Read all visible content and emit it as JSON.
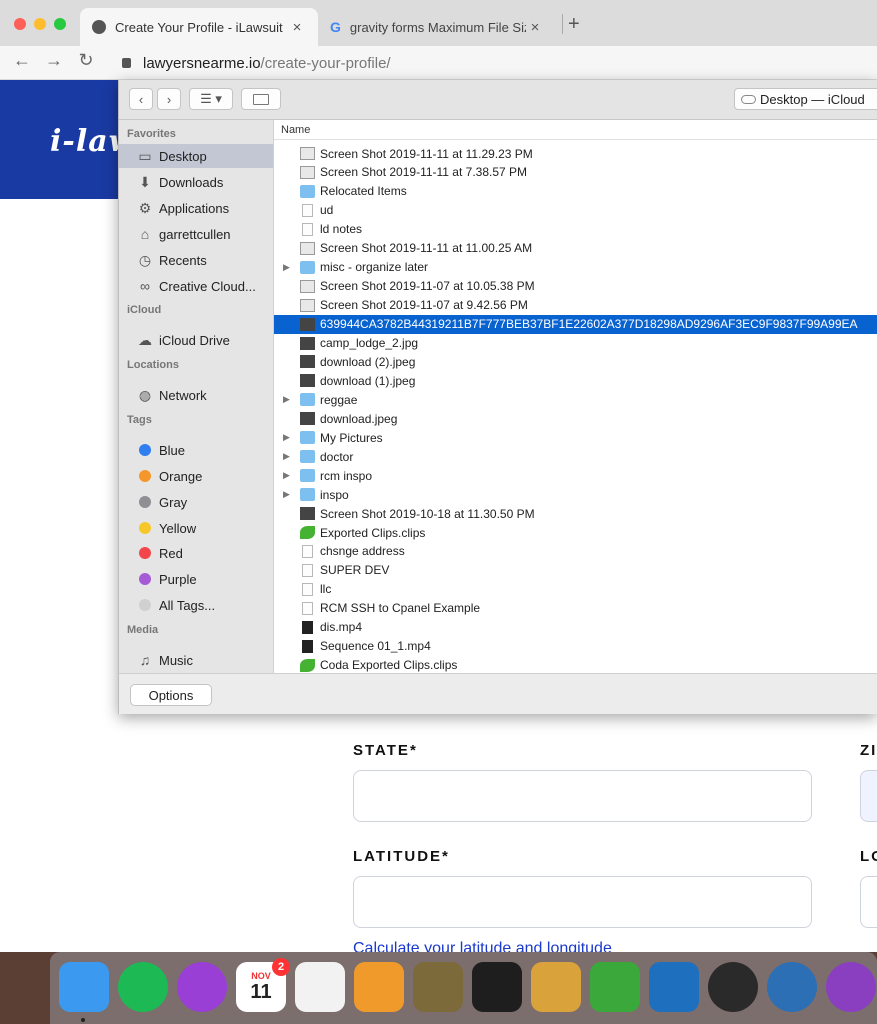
{
  "browser": {
    "tabs": [
      {
        "title": "Create Your Profile - iLawsuit",
        "close": "×"
      },
      {
        "title": "gravity forms Maximum File Size",
        "close": "×"
      }
    ],
    "new_tab": "+",
    "back": "←",
    "forward": "→",
    "reload": "↻",
    "url": {
      "domain": "lawyersnearme.io",
      "path": "/create-your-profile/"
    }
  },
  "page": {
    "logo": "i-law",
    "state_label": "STATE*",
    "zip_label": "ZI",
    "latitude_label": "LATITUDE*",
    "longitude_label": "LO",
    "calc_link": "Calculate your latitude and longitude"
  },
  "dialog": {
    "location": "Desktop — iCloud",
    "column_header": "Name",
    "options_button": "Options",
    "sidebar": [
      {
        "type": "header",
        "label": "Favorites"
      },
      {
        "type": "item",
        "label": "Desktop",
        "icon": "desktop-icon",
        "selected": true
      },
      {
        "type": "item",
        "label": "Downloads",
        "icon": "downloads-icon"
      },
      {
        "type": "item",
        "label": "Applications",
        "icon": "applications-icon"
      },
      {
        "type": "item",
        "label": "garrettcullen",
        "icon": "home-icon"
      },
      {
        "type": "item",
        "label": "Recents",
        "icon": "recents-icon"
      },
      {
        "type": "item",
        "label": "Creative Cloud...",
        "icon": "creative-cloud-icon"
      },
      {
        "type": "header",
        "label": "iCloud"
      },
      {
        "type": "item",
        "label": "iCloud Drive",
        "icon": "icloud-icon"
      },
      {
        "type": "header",
        "label": "Locations"
      },
      {
        "type": "item",
        "label": "Network",
        "icon": "network-icon"
      },
      {
        "type": "header",
        "label": "Tags"
      },
      {
        "type": "tag",
        "label": "Blue",
        "color": "#2f7ff0"
      },
      {
        "type": "tag",
        "label": "Orange",
        "color": "#f5962b"
      },
      {
        "type": "tag",
        "label": "Gray",
        "color": "#8e8e93"
      },
      {
        "type": "tag",
        "label": "Yellow",
        "color": "#f5c72b"
      },
      {
        "type": "tag",
        "label": "Red",
        "color": "#f2464a"
      },
      {
        "type": "tag",
        "label": "Purple",
        "color": "#a65bd6"
      },
      {
        "type": "tag",
        "label": "All Tags...",
        "color": "#d0d0d0"
      },
      {
        "type": "header",
        "label": "Media"
      },
      {
        "type": "item",
        "label": "Music",
        "icon": "music-icon"
      }
    ],
    "files": [
      {
        "name": "Screen Shot 2019-11-11 at 11.29.23 PM",
        "kind": "shot"
      },
      {
        "name": "Screen Shot 2019-11-11 at 7.38.57 PM",
        "kind": "shot"
      },
      {
        "name": "Relocated Items",
        "kind": "folder"
      },
      {
        "name": "ud",
        "kind": "doc"
      },
      {
        "name": "ld notes",
        "kind": "doc"
      },
      {
        "name": "Screen Shot 2019-11-11 at 11.00.25 AM",
        "kind": "shot"
      },
      {
        "name": "misc - organize later",
        "kind": "folder",
        "expandable": true
      },
      {
        "name": "Screen Shot 2019-11-07 at 10.05.38 PM",
        "kind": "shot"
      },
      {
        "name": "Screen Shot 2019-11-07 at 9.42.56 PM",
        "kind": "shot"
      },
      {
        "name": "639944CA3782B44319211B7F777BEB37BF1E22602A377D18298AD9296AF3EC9F9837F99A99EA",
        "kind": "img",
        "selected": true
      },
      {
        "name": "camp_lodge_2.jpg",
        "kind": "img"
      },
      {
        "name": "download (2).jpeg",
        "kind": "img"
      },
      {
        "name": "download (1).jpeg",
        "kind": "img"
      },
      {
        "name": "reggae",
        "kind": "folder",
        "expandable": true
      },
      {
        "name": "download.jpeg",
        "kind": "img"
      },
      {
        "name": "My Pictures",
        "kind": "folder",
        "expandable": true
      },
      {
        "name": "doctor",
        "kind": "folder",
        "expandable": true
      },
      {
        "name": "rcm inspo",
        "kind": "folder",
        "expandable": true
      },
      {
        "name": "inspo",
        "kind": "folder",
        "expandable": true
      },
      {
        "name": "Screen Shot 2019-10-18 at 11.30.50 PM",
        "kind": "img"
      },
      {
        "name": "Exported Clips.clips",
        "kind": "clip"
      },
      {
        "name": "chsnge address",
        "kind": "doc"
      },
      {
        "name": "SUPER DEV",
        "kind": "doc"
      },
      {
        "name": "llc",
        "kind": "doc"
      },
      {
        "name": "RCM SSH to Cpanel Example",
        "kind": "doc"
      },
      {
        "name": "dis.mp4",
        "kind": "vid"
      },
      {
        "name": "Sequence 01_1.mp4",
        "kind": "vid"
      },
      {
        "name": "Coda Exported Clips.clips",
        "kind": "clip"
      }
    ]
  },
  "dock": {
    "calendar_month": "NOV",
    "calendar_day": "11",
    "calendar_badge": "2",
    "apps": [
      {
        "name": "finder-icon",
        "color": "#3b9af0"
      },
      {
        "name": "spotify-icon",
        "color": "#1db954"
      },
      {
        "name": "podcasts-icon",
        "color": "#9a3fd6"
      },
      {
        "name": "calendar-icon",
        "color": "#ffffff"
      },
      {
        "name": "textedit-icon",
        "color": "#f2f2f2"
      },
      {
        "name": "calculator-icon",
        "color": "#f09a2c"
      },
      {
        "name": "gas-mask-icon",
        "color": "#7d6a3b"
      },
      {
        "name": "terminal-icon",
        "color": "#1e1e1e"
      },
      {
        "name": "sequel-pro-icon",
        "color": "#d9a23a"
      },
      {
        "name": "coda-icon",
        "color": "#3aa83a"
      },
      {
        "name": "vscode-icon",
        "color": "#1f6fbf"
      },
      {
        "name": "code-brackets-icon",
        "color": "#2a2a2a"
      },
      {
        "name": "mysql-workbench-icon",
        "color": "#2c6fb5"
      },
      {
        "name": "github-desktop-icon",
        "color": "#8a3fc0"
      }
    ]
  }
}
